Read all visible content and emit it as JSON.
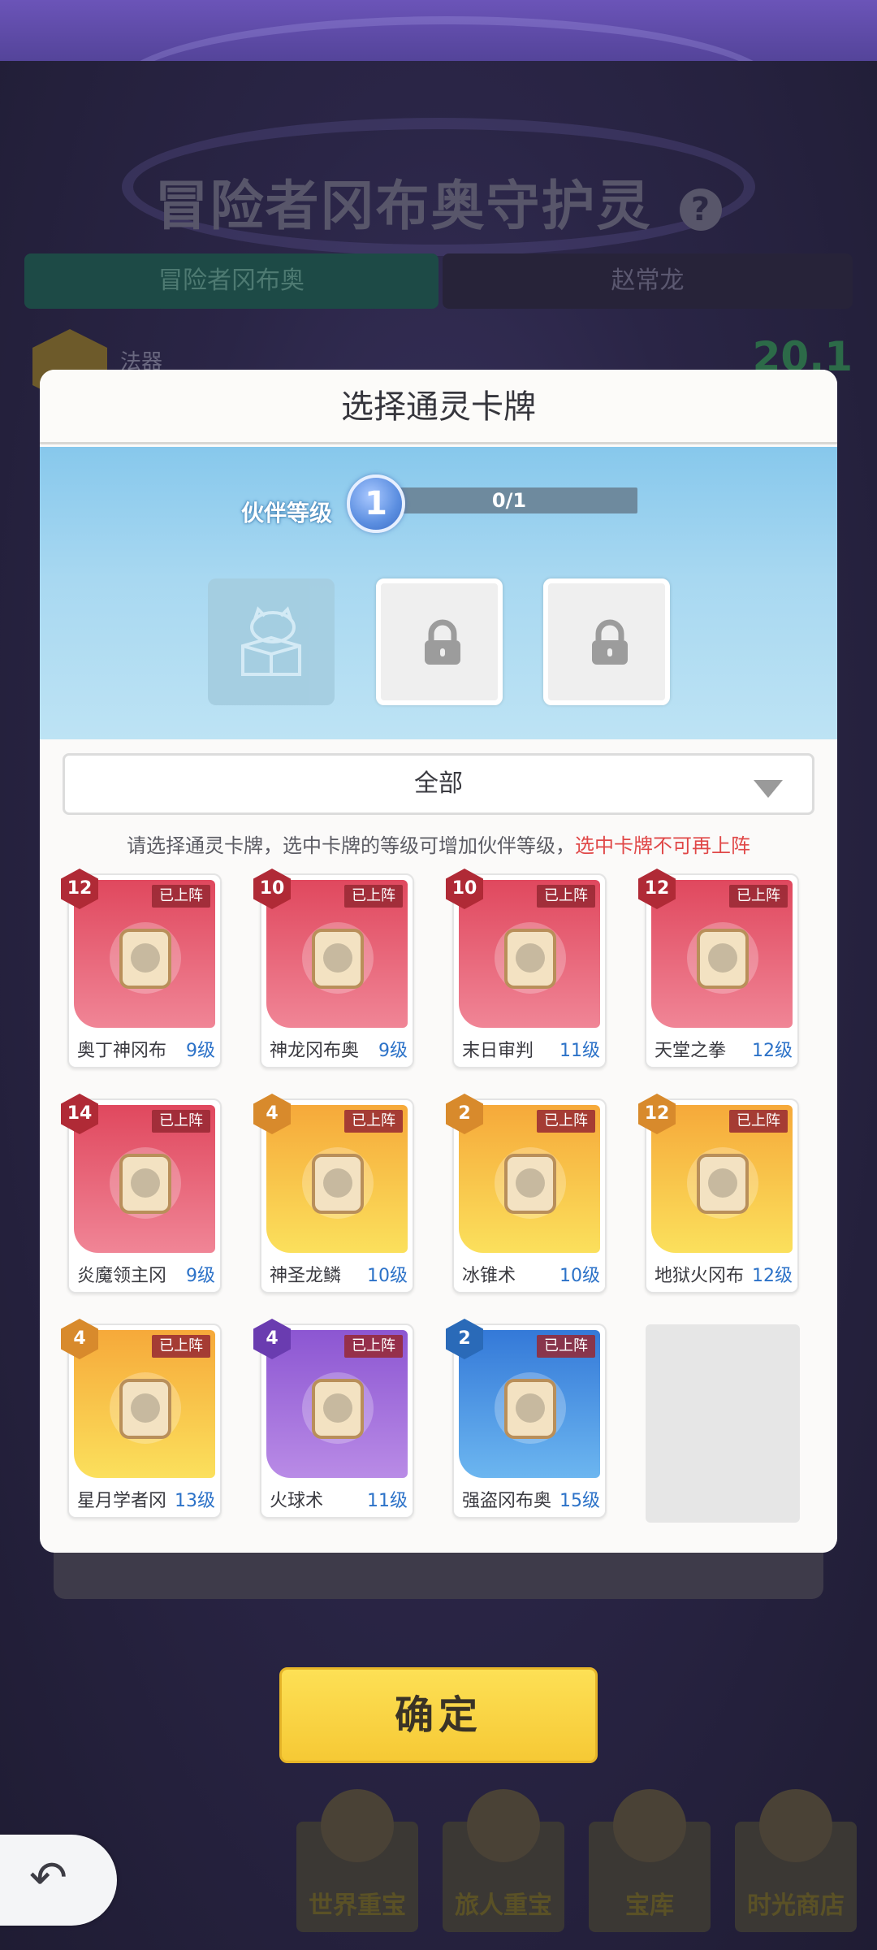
{
  "background": {
    "title": "冒险者冈布奥守护灵",
    "help_label": "?",
    "tabs": [
      "冒险者冈布奥",
      "赵常龙"
    ],
    "fabao_label": "法器",
    "value_text": "20.1"
  },
  "modal": {
    "title": "选择通灵卡牌",
    "partner_level_label": "伙伴等级",
    "partner_level": "1",
    "progress_text": "0/1",
    "progress_fraction": 0.0,
    "filter_value": "全部",
    "hint_text": "请选择通灵卡牌，选中卡牌的等级可增加伙伴等级，",
    "hint_warning": "选中卡牌不可再上阵",
    "cards": [
      {
        "level": "12",
        "name": "奥丁神冈布",
        "lv": "9级",
        "tag": "已上阵",
        "color": "red",
        "icon": "odin-gumball-art"
      },
      {
        "level": "10",
        "name": "神龙冈布奥",
        "lv": "9级",
        "tag": "已上阵",
        "color": "red",
        "icon": "dragon-gumball-art"
      },
      {
        "level": "10",
        "name": "末日审判",
        "lv": "11级",
        "tag": "已上阵",
        "color": "red",
        "icon": "mushroom-scroll-art"
      },
      {
        "level": "12",
        "name": "天堂之拳",
        "lv": "12级",
        "tag": "已上阵",
        "color": "red",
        "icon": "fist-scroll-art"
      },
      {
        "level": "14",
        "name": "炎魔领主冈",
        "lv": "9级",
        "tag": "已上阵",
        "color": "red",
        "icon": "flame-lord-art"
      },
      {
        "level": "4",
        "name": "神圣龙鳞",
        "lv": "10级",
        "tag": "已上阵",
        "color": "orange",
        "icon": "dragon-scale-art"
      },
      {
        "level": "2",
        "name": "冰锥术",
        "lv": "10级",
        "tag": "已上阵",
        "color": "orange",
        "icon": "ice-scroll-art"
      },
      {
        "level": "12",
        "name": "地狱火冈布",
        "lv": "12级",
        "tag": "已上阵",
        "color": "orange",
        "icon": "hellfire-gumball-art"
      },
      {
        "level": "4",
        "name": "星月学者冈",
        "lv": "13级",
        "tag": "已上阵",
        "color": "orange",
        "icon": "star-scholar-art"
      },
      {
        "level": "4",
        "name": "火球术",
        "lv": "11级",
        "tag": "已上阵",
        "color": "purple",
        "icon": "fireball-scroll-art"
      },
      {
        "level": "2",
        "name": "强盗冈布奥",
        "lv": "15级",
        "tag": "已上阵",
        "color": "blue",
        "icon": "bandit-gumball-art"
      }
    ]
  },
  "confirm_label": "确定",
  "shop": [
    "世界重宝",
    "旅人重宝",
    "宝库",
    "时光商店"
  ],
  "back_icon": "back-arrow-icon"
}
